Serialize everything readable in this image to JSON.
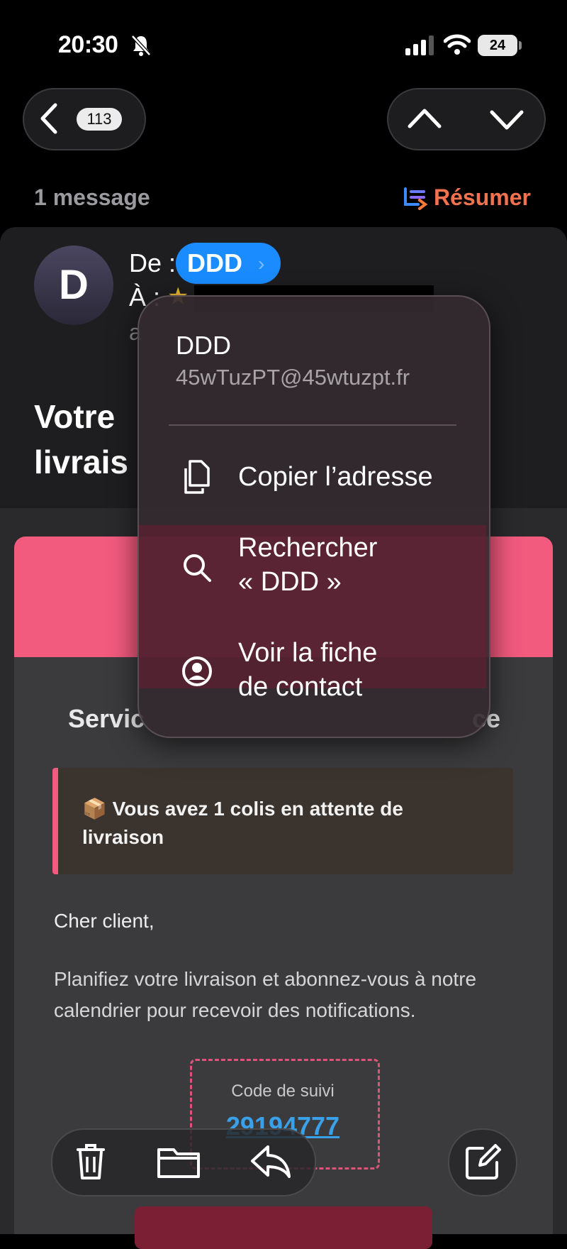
{
  "status_bar": {
    "time": "20:30",
    "battery": "24",
    "icons": [
      "bell-slash-icon",
      "signal-icon",
      "wifi-icon",
      "battery-icon"
    ]
  },
  "nav": {
    "back_count": "113",
    "icons": [
      "chevron-left-icon",
      "chevron-up-icon",
      "chevron-down-icon"
    ]
  },
  "thread": {
    "message_count": "1 message",
    "summarize_label": "Résumer"
  },
  "header": {
    "avatar_letter": "D",
    "from_label": "De :",
    "sender_chip": "DDD",
    "to_label": "À :",
    "cc_fragment": "a",
    "subject_line1": "Votre",
    "subject_line2": "livrais"
  },
  "context_menu": {
    "name": "DDD",
    "email": "45wTuzPT@45wtuzpt.fr",
    "items": [
      {
        "label": "Copier l’adresse",
        "icon": "copy-icon"
      },
      {
        "label_line1": "Rechercher",
        "label_line2": "« DDD »",
        "icon": "search-icon"
      },
      {
        "label_line1": "Voir la fiche",
        "label_line2": "de contact",
        "icon": "contact-icon"
      }
    ]
  },
  "email": {
    "service_fragment": "Servic",
    "service_end": "ce",
    "alert_text": "📦 Vous avez 1 colis en attente de livraison",
    "greeting": "Cher client,",
    "paragraph": "Planifiez votre livraison et abonnez-vous à notre calendrier pour recevoir des notifications.",
    "code_label": "Code de suivi",
    "code_value": "29194777",
    "accent_color": "#f25a7e"
  },
  "toolbar": {
    "icons": [
      "trash-icon",
      "folder-icon",
      "reply-icon",
      "compose-icon"
    ]
  }
}
